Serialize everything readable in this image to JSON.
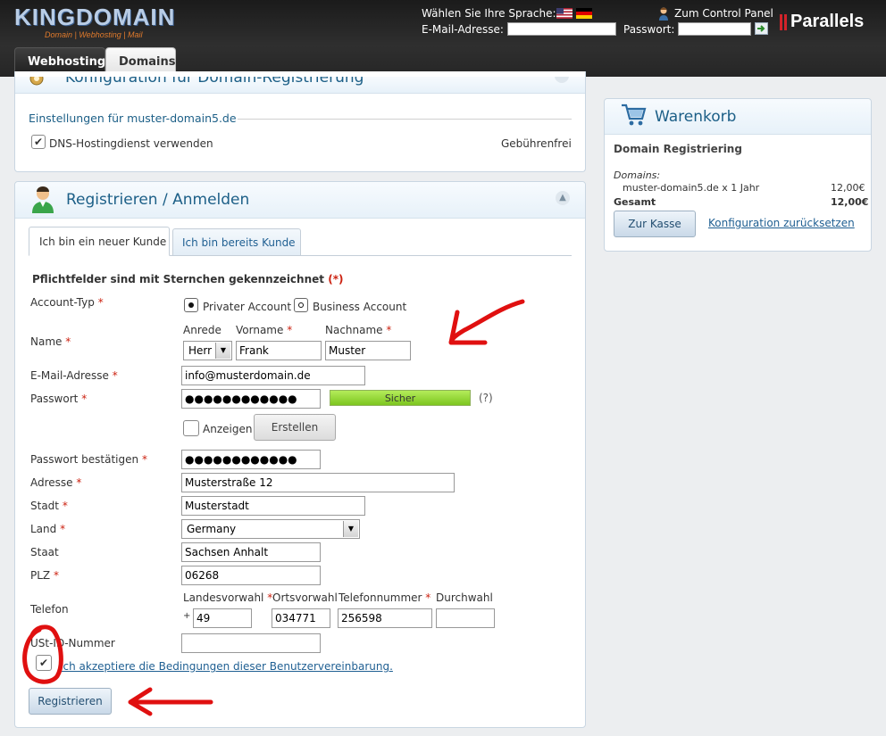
{
  "header": {
    "logo_text": "KINGDOMAIN",
    "logo_tagline": "Domain | Webhosting | Mail",
    "language_label": "Wählen Sie Ihre Sprache:",
    "email_label": "E-Mail-Adresse:",
    "password_label": "Passwort:",
    "control_panel_link": "Zum Control Panel",
    "parallels_logo": "Parallels"
  },
  "tabs": [
    {
      "label": "Webhosting"
    },
    {
      "label": "Domains"
    }
  ],
  "config_panel": {
    "title": "Konfiguration für Domain-Registrierung",
    "settings_heading": "Einstellungen für muster-domain5.de",
    "dns_option": "DNS-Hostingdienst verwenden",
    "dns_price": "Gebührenfrei"
  },
  "register_panel": {
    "title": "Registrieren / Anmelden",
    "tab_new": "Ich bin ein neuer Kunde",
    "tab_existing": "Ich bin bereits Kunde",
    "required_note": "Pflichtfelder sind mit Sternchen gekennzeichnet",
    "required_note_mark": "(*)",
    "account_type_label": "Account-Typ",
    "private_account": "Privater Account",
    "business_account": "Business Account",
    "name_label": "Name",
    "salutation_label": "Anrede",
    "firstname_label": "Vorname",
    "lastname_label": "Nachname",
    "salutation_value": "Herr",
    "firstname_value": "Frank",
    "lastname_value": "Muster",
    "email_label": "E-Mail-Adresse",
    "email_value": "info@musterdomain.de",
    "password_label": "Passwort",
    "password_value": "●●●●●●●●●●●●",
    "strength_label": "Sicher",
    "help": "(?)",
    "show_label": "Anzeigen",
    "generate_button": "Erstellen",
    "confirm_label": "Passwort bestätigen",
    "confirm_value": "●●●●●●●●●●●●",
    "address_label": "Adresse",
    "address_value": "Musterstraße 12",
    "city_label": "Stadt",
    "city_value": "Musterstadt",
    "country_label": "Land",
    "country_value": "Germany",
    "state_label": "Staat",
    "state_value": "Sachsen Anhalt",
    "zip_label": "PLZ",
    "zip_value": "06268",
    "phone_label": "Telefon",
    "country_code_label": "Landesvorwahl",
    "area_code_label": "Ortsvorwahl",
    "phone_number_label": "Telefonnummer",
    "extension_label": "Durchwahl",
    "plus": "+",
    "country_code_value": "49",
    "area_code_value": "034771",
    "phone_number_value": "256598",
    "extension_value": "",
    "vat_label": "USt-ID-Nummer",
    "vat_value": "",
    "terms_text": "Ich akzeptiere die Bedingungen dieser Benutzervereinbarung.",
    "register_button": "Registrieren",
    "asterisk": "*"
  },
  "cart": {
    "title": "Warenkorb",
    "subtitle": "Domain Registriering",
    "domains_label": "Domains:",
    "item": "muster-domain5.de x 1 Jahr",
    "item_price": "12,00€",
    "total_label": "Gesamt",
    "total_price": "12,00€",
    "checkout_button": "Zur Kasse",
    "reset_link": "Konfiguration zurücksetzen"
  },
  "colors": {
    "accent": "#1c5f87",
    "strength_bar": "#8fd62c",
    "annotation": "#e01010"
  }
}
